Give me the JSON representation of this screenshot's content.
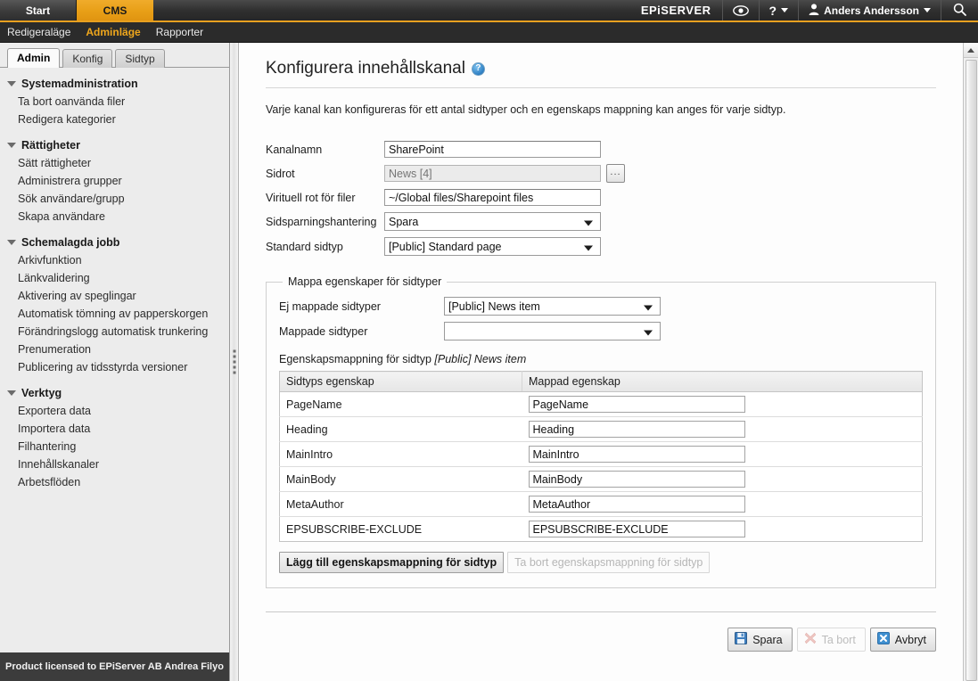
{
  "header": {
    "tabs": [
      {
        "label": "Start",
        "active": false
      },
      {
        "label": "CMS",
        "active": true
      }
    ],
    "logo": "EPiSERVER",
    "eye_icon": "eye-icon",
    "help_icon": "question-mark-icon",
    "user_icon": "user-avatar-icon",
    "user_name": "Anders Andersson",
    "search_icon": "search-icon",
    "accent_color": "#e8a020",
    "bar_color": "#303030"
  },
  "subnav": {
    "items": [
      {
        "label": "Redigeraläge",
        "active": false
      },
      {
        "label": "Adminläge",
        "active": true
      },
      {
        "label": "Rapporter",
        "active": false
      }
    ]
  },
  "sidebar": {
    "tabs": [
      {
        "label": "Admin",
        "active": true
      },
      {
        "label": "Konfig",
        "active": false
      },
      {
        "label": "Sidtyp",
        "active": false
      }
    ],
    "groups": [
      {
        "title": "Systemadministration",
        "items": [
          "Ta bort oanvända filer",
          "Redigera kategorier"
        ]
      },
      {
        "title": "Rättigheter",
        "items": [
          "Sätt rättigheter",
          "Administrera grupper",
          "Sök användare/grupp",
          "Skapa användare"
        ]
      },
      {
        "title": "Schemalagda jobb",
        "items": [
          "Arkivfunktion",
          "Länkvalidering",
          "Aktivering av speglingar",
          "Automatisk tömning av papperskorgen",
          "Förändringslogg automatisk trunkering",
          "Prenumeration",
          "Publicering av tidsstyrda versioner"
        ]
      },
      {
        "title": "Verktyg",
        "items": [
          "Exportera data",
          "Importera data",
          "Filhantering",
          "Innehållskanaler",
          "Arbetsflöden"
        ]
      }
    ],
    "license": "Product licensed to EPiServer AB Andrea Filyo"
  },
  "main": {
    "title": "Konfigurera innehållskanal",
    "help_icon": "help-circle-icon",
    "description": "Varje kanal kan konfigureras för ett antal sidtyper och en egenskaps mappning kan anges för varje sidtyp.",
    "fields": [
      {
        "label": "Kanalnamn",
        "type": "text",
        "value": "SharePoint",
        "placeholder": "",
        "disabled": false,
        "browse": false
      },
      {
        "label": "Sidrot",
        "type": "text",
        "value": "",
        "placeholder": "News [4]",
        "disabled": true,
        "browse": true,
        "browse_label": "..."
      },
      {
        "label": "Virituell rot för filer",
        "type": "text",
        "value": "~/Global files/Sharepoint files",
        "placeholder": "",
        "disabled": false,
        "browse": false
      },
      {
        "label": "Sidsparningshantering",
        "type": "select",
        "value": "Spara",
        "options": [
          "Spara"
        ]
      },
      {
        "label": "Standard sidtyp",
        "type": "select",
        "value": "[Public] Standard page",
        "options": [
          "[Public] Standard page"
        ]
      }
    ],
    "mapper": {
      "legend": "Mappa egenskaper för sidtyper",
      "unmapped_label": "Ej mappade sidtyper",
      "unmapped_value": "[Public] News item",
      "unmapped_options": [
        "[Public] News item"
      ],
      "mapped_label": "Mappade sidtyper",
      "mapped_value": "",
      "mapped_options": [
        ""
      ],
      "caption_prefix": "Egenskapsmappning för sidtyp ",
      "caption_pagetype": "[Public] News item",
      "table": {
        "columns": [
          "Sidtyps egenskap",
          "Mappad egenskap"
        ],
        "rows": [
          {
            "property": "PageName",
            "mapped": "PageName"
          },
          {
            "property": "Heading",
            "mapped": "Heading"
          },
          {
            "property": "MainIntro",
            "mapped": "MainIntro"
          },
          {
            "property": "MainBody",
            "mapped": "MainBody"
          },
          {
            "property": "MetaAuthor",
            "mapped": "MetaAuthor"
          },
          {
            "property": "EPSUBSCRIBE-EXCLUDE",
            "mapped": "EPSUBSCRIBE-EXCLUDE"
          }
        ]
      },
      "add_button": "Lägg till egenskapsmappning för sidtyp",
      "remove_button": "Ta bort egenskapsmappning för sidtyp",
      "remove_disabled": true
    },
    "actions": [
      {
        "label": "Spara",
        "icon": "save-floppy-icon",
        "disabled": false
      },
      {
        "label": "Ta bort",
        "icon": "delete-x-icon",
        "disabled": true
      },
      {
        "label": "Avbryt",
        "icon": "cancel-x-icon",
        "disabled": false
      }
    ]
  },
  "scrollbar": {
    "up_arrow": "arrow-up-icon"
  }
}
